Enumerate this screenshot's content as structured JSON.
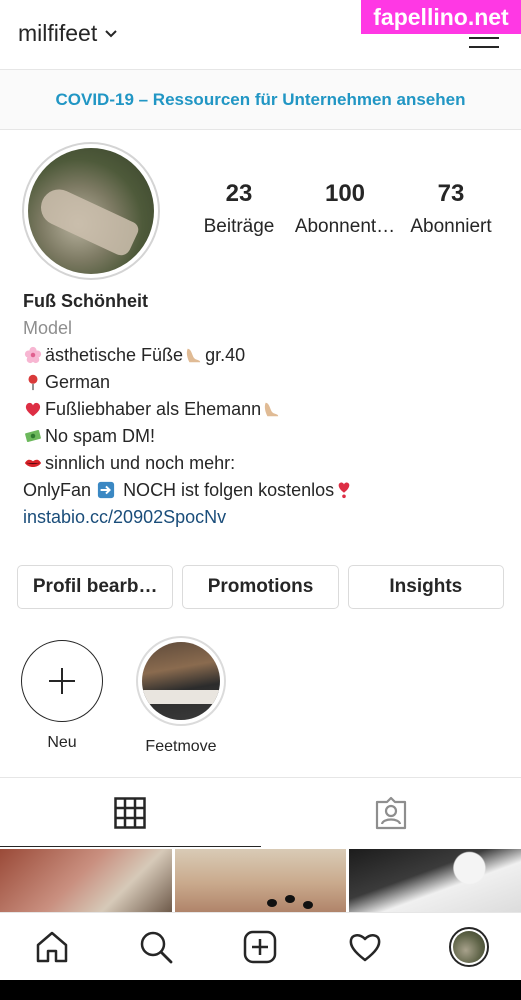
{
  "header": {
    "username": "milfifeet",
    "watermark": "fapellino.net"
  },
  "banner": {
    "text": "COVID-19 – Ressourcen für Unternehmen ansehen"
  },
  "stats": [
    {
      "value": "23",
      "label": "Beiträge"
    },
    {
      "value": "100",
      "label": "Abonnent…"
    },
    {
      "value": "73",
      "label": "Abonniert"
    }
  ],
  "bio": {
    "name": "Fuß Schönheit",
    "category": "Model",
    "lines": [
      "ästhetische Füße",
      "gr.40",
      "German",
      "Fußliebhaber als Ehemann",
      "No spam DM!",
      "sinnlich und noch mehr:",
      "OnlyFan",
      "NOCH ist folgen kostenlos"
    ],
    "link": "instabio.cc/20902SpocNv"
  },
  "buttons": {
    "edit": "Profil bearb…",
    "promotions": "Promotions",
    "insights": "Insights"
  },
  "highlights": [
    {
      "label": "Neu"
    },
    {
      "label": "Feetmove"
    }
  ],
  "icons": {
    "chevron": "chevron-down-icon",
    "menu": "hamburger-menu-icon",
    "grid": "grid-icon",
    "tagged": "tagged-person-icon",
    "home": "home-icon",
    "search": "search-icon",
    "add": "add-post-icon",
    "activity": "heart-icon",
    "profile": "profile-avatar-icon"
  },
  "colors": {
    "accent_link": "#2196c4",
    "text": "#262626",
    "muted": "#8e8e8e",
    "watermark_bg": "#ff38e4"
  }
}
